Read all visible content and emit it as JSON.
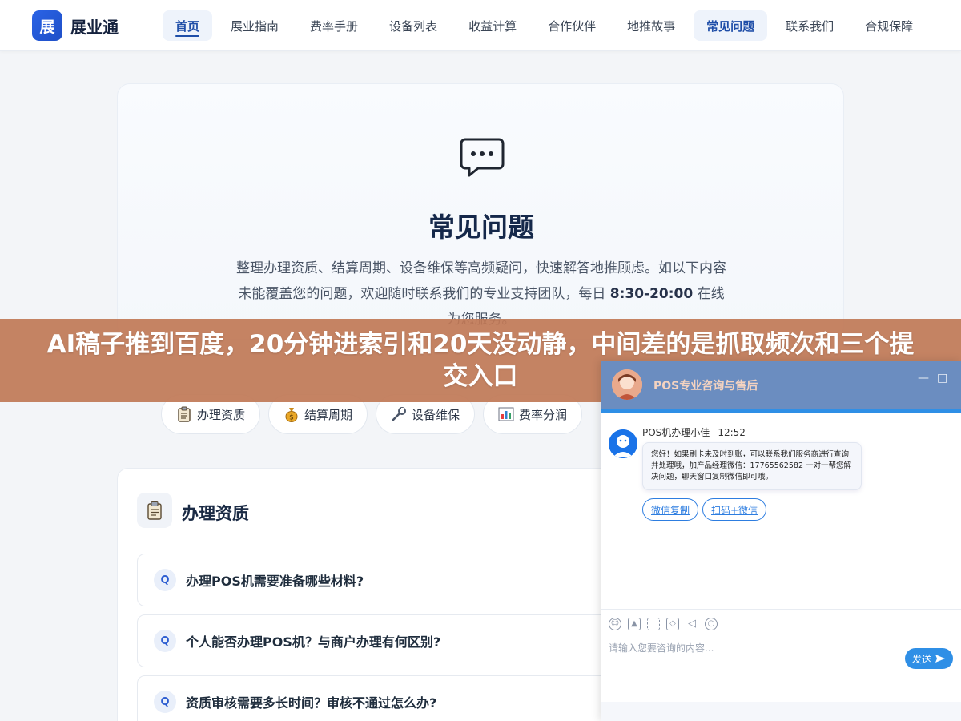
{
  "brand": {
    "logo_char": "展",
    "name": "展业通"
  },
  "nav": {
    "items": [
      {
        "label": "首页"
      },
      {
        "label": "展业指南"
      },
      {
        "label": "费率手册"
      },
      {
        "label": "设备列表"
      },
      {
        "label": "收益计算"
      },
      {
        "label": "合作伙伴"
      },
      {
        "label": "地推故事"
      },
      {
        "label": "常见问题"
      },
      {
        "label": "联系我们"
      },
      {
        "label": "合规保障"
      }
    ],
    "active_index": 0,
    "highlight_index": 7
  },
  "hero": {
    "title": "常见问题",
    "desc_before": "整理办理资质、结算周期、设备维保等高频疑问，快速解答地推顾虑。如以下内容未能覆盖您的问题，欢迎随时联系我们的专业支持团队，每日 ",
    "desc_hours": "8:30-20:00",
    "desc_after": " 在线为您服务。"
  },
  "banner": {
    "text": "AI稿子推到百度，20分钟进索引和20天没动静，中间差的是抓取频次和三个提交入口"
  },
  "chips": [
    {
      "label": "办理资质",
      "icon": "clipboard-icon"
    },
    {
      "label": "结算周期",
      "icon": "money-bag-icon"
    },
    {
      "label": "设备维保",
      "icon": "wrench-icon"
    },
    {
      "label": "费率分润",
      "icon": "bar-chart-icon"
    }
  ],
  "section": {
    "title": "办理资质",
    "q_badge": "Q",
    "faqs": [
      {
        "q": "办理POS机需要准备哪些材料?"
      },
      {
        "q": "个人能否办理POS机？与商户办理有何区别?"
      },
      {
        "q": "资质审核需要多长时间？审核不通过怎么办?"
      }
    ]
  },
  "chat": {
    "title": "POS专业咨询与售后",
    "minimize": "—",
    "maximize": "□",
    "agent_name": "POS机办理小佳",
    "time": "12:52",
    "message": "您好！如果刷卡未及时到账，可以联系我们服务商进行查询并处理哦，加产品经理微信：17765562582 一对一帮您解决问题，聊天窗口复制微信即可哦。",
    "quick_buttons": [
      {
        "label": "微信复制"
      },
      {
        "label": "扫码+微信"
      }
    ],
    "tools": [
      "emoji-icon",
      "image-icon",
      "screenshot-icon",
      "shield-icon",
      "mute-icon",
      "wechat-icon"
    ],
    "input_placeholder": "请输入您要咨询的内容...",
    "send_label": "发送",
    "accent": "#2f8fe6"
  }
}
